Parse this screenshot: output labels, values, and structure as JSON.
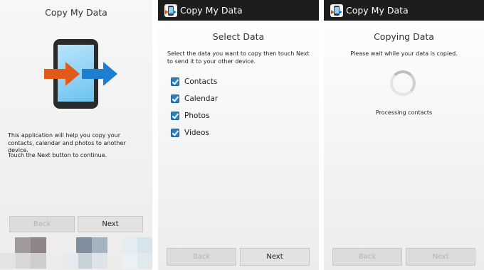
{
  "screen1": {
    "title": "Copy My Data",
    "description": "This application will help you copy your contacts, calendar and photos to another device.",
    "instruction": "Touch the Next button to continue.",
    "back_label": "Back",
    "next_label": "Next"
  },
  "screen2": {
    "app_title": "Copy My Data",
    "heading": "Select Data",
    "instruction": "Select the data you want to copy then touch Next to send it to your other device.",
    "options": [
      {
        "label": "Contacts",
        "checked": true
      },
      {
        "label": "Calendar",
        "checked": true
      },
      {
        "label": "Photos",
        "checked": true
      },
      {
        "label": "Videos",
        "checked": true
      }
    ],
    "back_label": "Back",
    "next_label": "Next"
  },
  "screen3": {
    "app_title": "Copy My Data",
    "heading": "Copying Data",
    "message": "Please wait while your data is copied.",
    "status": "Processing contacts",
    "back_label": "Back",
    "next_label": "Next"
  },
  "colors": {
    "actionbar": "#1d1d1d",
    "arrow_left": "#e05a1a",
    "arrow_right": "#1e7fd0",
    "checkbox": "#2a7fc0"
  }
}
